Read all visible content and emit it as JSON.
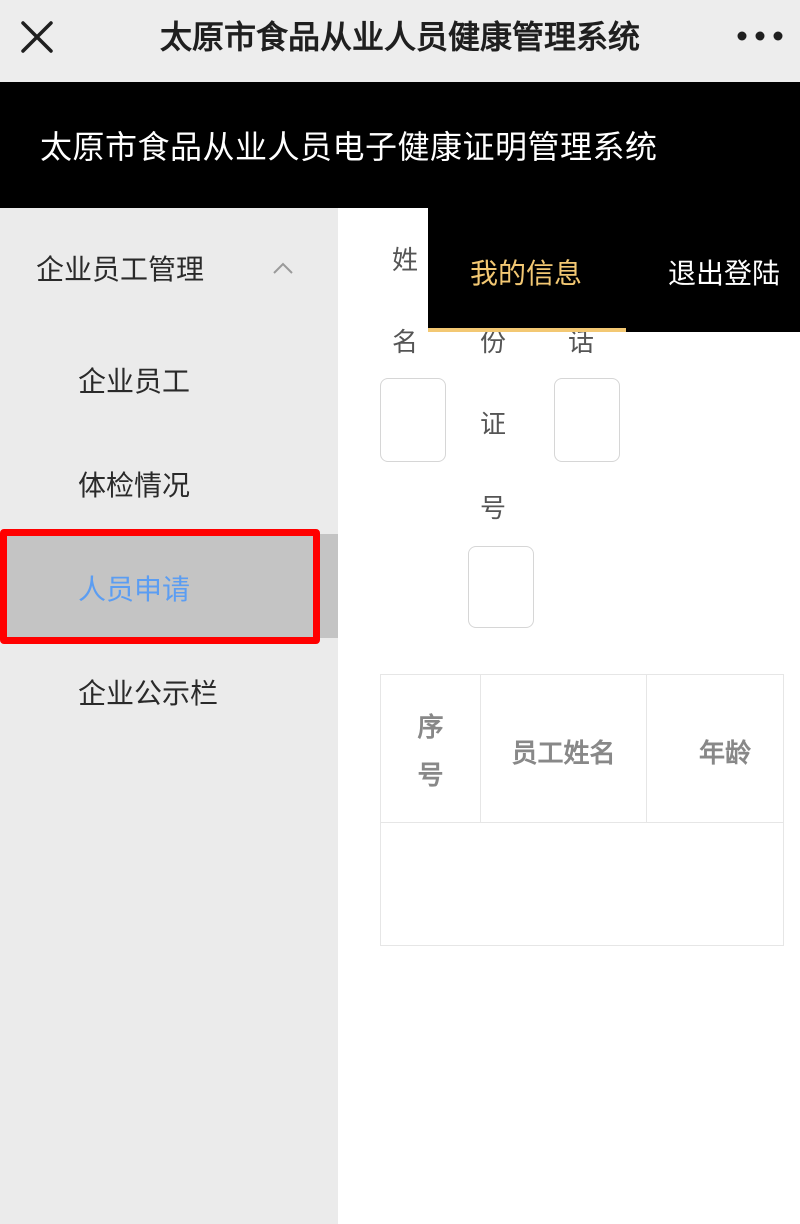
{
  "navbar": {
    "title": "太原市食品从业人员健康管理系统",
    "close_icon": "close-icon",
    "more_icon": "more-icon"
  },
  "header": {
    "title": "太原市食品从业人员电子健康证明管理系统"
  },
  "sidebar": {
    "group": {
      "label": "企业员工管理",
      "expanded": true,
      "icon": "chevron-up-icon"
    },
    "items": [
      {
        "label": "企业员工",
        "active": false
      },
      {
        "label": "体检情况",
        "active": false
      },
      {
        "label": "人员申请",
        "active": true
      },
      {
        "label": "企业公示栏",
        "active": false
      }
    ]
  },
  "user_menu": {
    "tabs": [
      {
        "label": "我的信息",
        "active": true
      },
      {
        "label": "退出登陆",
        "active": false
      }
    ]
  },
  "form": {
    "name_label_chars": [
      "姓",
      "名"
    ],
    "id_label_chars": [
      "份",
      "证",
      "号"
    ],
    "phone_label_chars": [
      "话"
    ],
    "name_value": "",
    "id_value": "",
    "phone_value": ""
  },
  "table": {
    "columns": [
      {
        "label_lines": [
          "序",
          "号"
        ]
      },
      {
        "label_lines": [
          "员工姓名"
        ]
      },
      {
        "label_lines": [
          "年龄"
        ]
      }
    ],
    "rows": []
  },
  "colors": {
    "active_link": "#5b9df2",
    "menu_accent": "#f3c873",
    "annotation_red": "#ff0000"
  }
}
